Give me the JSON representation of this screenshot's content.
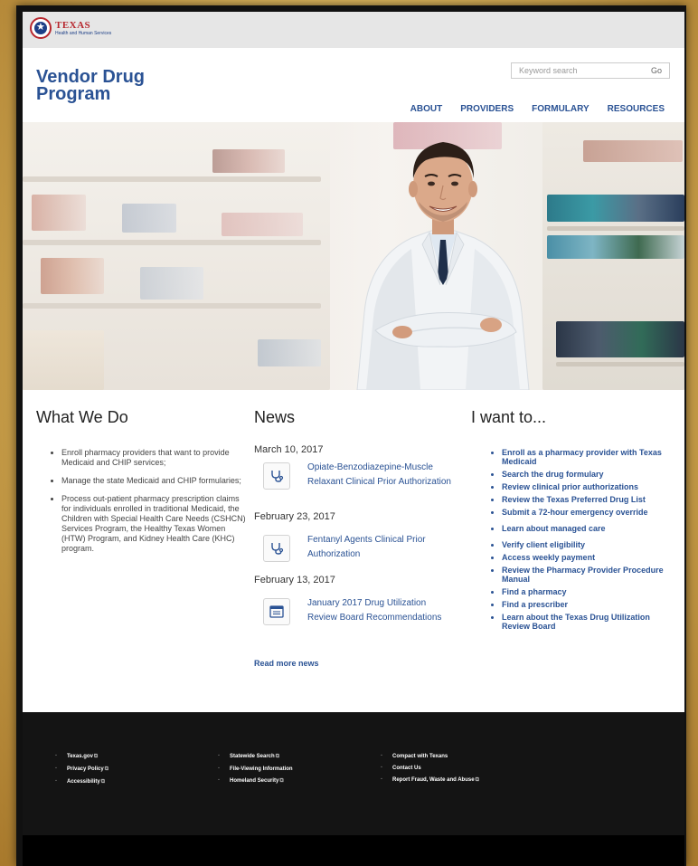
{
  "topbar": {
    "logo_line1": "TEXAS",
    "logo_line2": "Health and Human Services"
  },
  "header": {
    "title_line1": "Vendor Drug",
    "title_line2": "Program",
    "search": {
      "placeholder": "Keyword search",
      "button": "Go"
    },
    "nav": [
      "ABOUT",
      "PROVIDERS",
      "FORMULARY",
      "RESOURCES"
    ]
  },
  "what_we_do": {
    "heading": "What We Do",
    "items": [
      "Enroll pharmacy providers that want to provide Medicaid and CHIP services;",
      "Manage the state Medicaid and CHIP formularies;",
      "Process out-patient pharmacy prescription claims for individuals enrolled in traditional Medicaid, the Children with Special Health Care Needs (CSHCN) Services Program, the Healthy Texas Women (HTW) Program, and Kidney Health Care (KHC) program."
    ]
  },
  "news": {
    "heading": "News",
    "items": [
      {
        "date": "March 10, 2017",
        "title": "Opiate-Benzodiazepine-Muscle Relaxant Clinical Prior Authorization",
        "icon": "stethoscope-icon"
      },
      {
        "date": "February 23, 2017",
        "title": "Fentanyl Agents Clinical Prior Authorization",
        "icon": "stethoscope-icon"
      },
      {
        "date": "February 13, 2017",
        "title": "January 2017 Drug Utilization Review Board Recommendations",
        "icon": "document-icon"
      }
    ],
    "read_more": "Read more news"
  },
  "i_want_to": {
    "heading": "I want to...",
    "links": [
      "Enroll as a pharmacy provider with Texas Medicaid",
      "Search the drug formulary",
      "Review clinical prior authorizations",
      "Review the Texas Preferred Drug List",
      "Submit a 72-hour emergency override",
      "Learn about managed care",
      "Verify client eligibility",
      "Access weekly payment",
      "Review the Pharmacy Provider Procedure Manual",
      "Find a pharmacy",
      "Find a prescriber",
      "Learn about the Texas Drug Utilization Review Board"
    ]
  },
  "footer": {
    "col1": [
      "Texas.gov",
      "Privacy Policy",
      "Accessibility"
    ],
    "col2": [
      "Statewide Search",
      "File-Viewing Information",
      "Homeland Security"
    ],
    "col3": [
      "Compact with Texans",
      "Contact Us",
      "Report Fraud, Waste and Abuse"
    ]
  },
  "colors": {
    "link": "#2a5294",
    "footer_bg": "#141414",
    "logo_red": "#b7272e"
  }
}
